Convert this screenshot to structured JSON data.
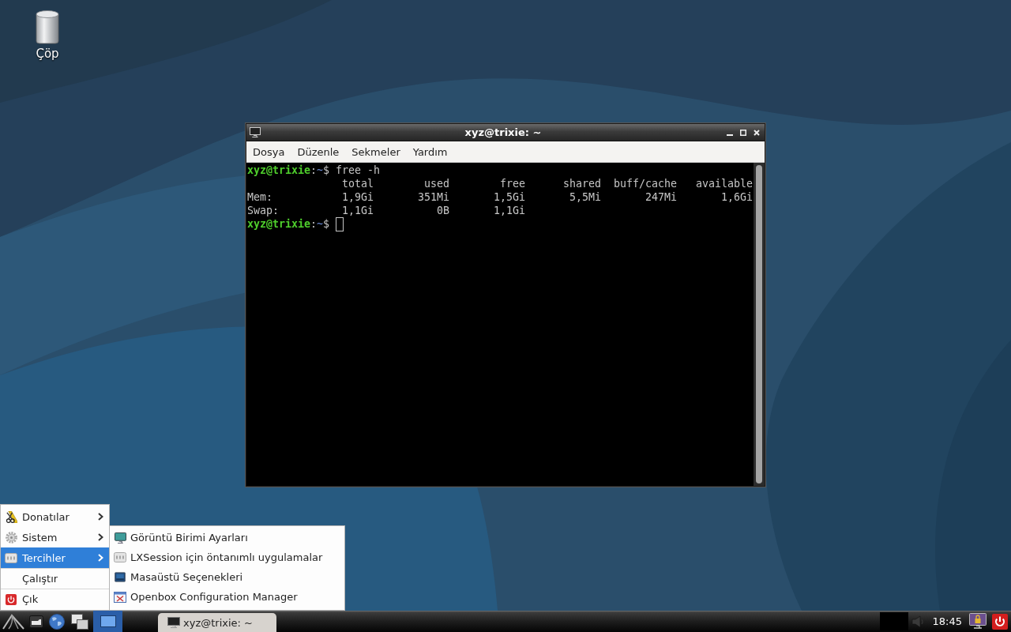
{
  "desktop_icons": [
    {
      "label": "Çöp"
    }
  ],
  "terminal_window": {
    "title": "xyz@trixie: ~",
    "menu": [
      "Dosya",
      "Düzenle",
      "Sekmeler",
      "Yardım"
    ],
    "session": [
      {
        "kind": "prompt",
        "user": "xyz@trixie",
        "separator": ":",
        "path": "~",
        "symbol": "$",
        "command": "free -h",
        "cursor": false
      },
      {
        "kind": "table",
        "columns": [
          "total",
          "used",
          "free",
          "shared",
          "buff/cache",
          "available"
        ],
        "rows": [
          {
            "label": "Mem:",
            "values": [
              "1,9Gi",
              "351Mi",
              "1,5Gi",
              "5,5Mi",
              "247Mi",
              "1,6Gi"
            ]
          },
          {
            "label": "Swap:",
            "values": [
              "1,1Gi",
              "0B",
              "1,1Gi"
            ]
          }
        ]
      },
      {
        "kind": "prompt",
        "user": "xyz@trixie",
        "separator": ":",
        "path": "~",
        "symbol": "$",
        "cursor": true
      }
    ]
  },
  "start_menu": {
    "items": [
      {
        "label": "Donatılar",
        "submenu": true,
        "selected": false,
        "separator_before": false
      },
      {
        "label": "Sistem",
        "submenu": true,
        "selected": false,
        "separator_before": false
      },
      {
        "label": "Tercihler",
        "submenu": true,
        "selected": true,
        "separator_before": false
      },
      {
        "label": "Çalıştır",
        "submenu": false,
        "selected": false,
        "separator_before": true
      },
      {
        "label": "Çık",
        "submenu": false,
        "selected": false,
        "separator_before": true
      }
    ]
  },
  "submenu": {
    "items": [
      {
        "label": "Görüntü Birimi Ayarları",
        "selected": false
      },
      {
        "label": "LXSession için öntanımlı uygulamalar",
        "selected": false
      },
      {
        "label": "Masaüstü Seçenekleri",
        "selected": false
      },
      {
        "label": "Openbox Configuration Manager",
        "selected": false
      }
    ]
  },
  "taskbar": {
    "tasks": [
      {
        "label": "xyz@trixie: ~"
      }
    ],
    "clock": "18:45"
  }
}
